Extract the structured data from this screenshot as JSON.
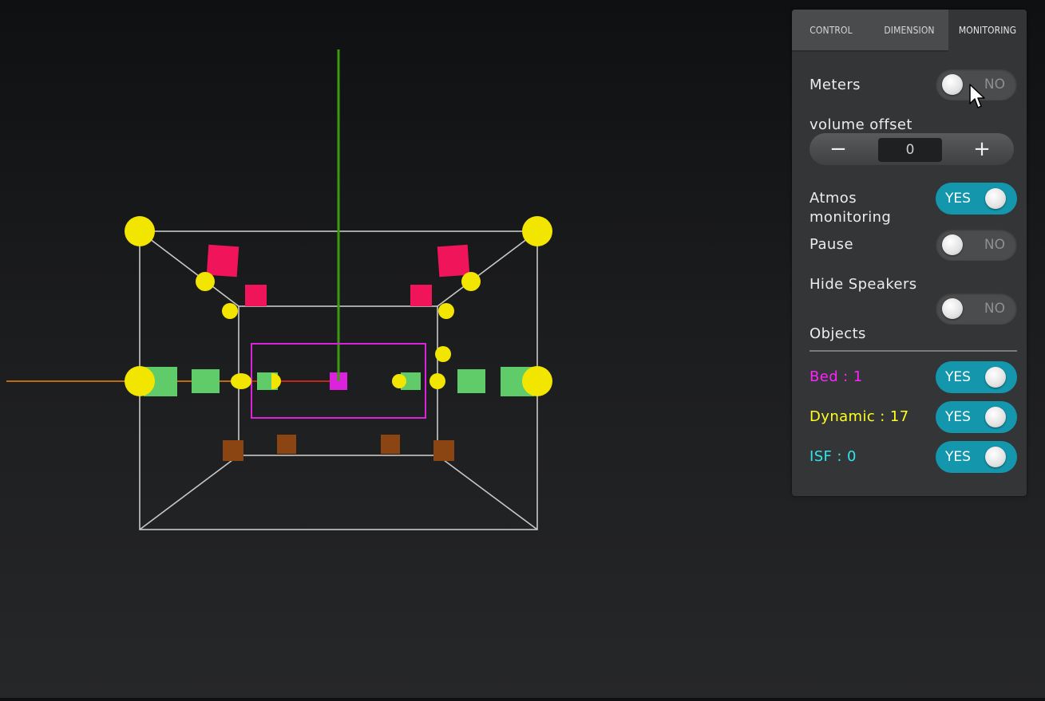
{
  "tabs": [
    {
      "label": "CONTROL",
      "active": false
    },
    {
      "label": "DIMENSION",
      "active": false
    },
    {
      "label": "MONITORING",
      "active": true
    }
  ],
  "meters": {
    "label": "Meters",
    "state": "NO"
  },
  "volume_offset": {
    "label": "volume offset",
    "value": "0",
    "minus": "−",
    "plus": "+"
  },
  "atmos": {
    "label_line1": "Atmos",
    "label_line2": "monitoring",
    "state": "YES"
  },
  "pause": {
    "label": "Pause",
    "state": "NO"
  },
  "hide_speakers": {
    "label": "Hide Speakers",
    "state": "NO"
  },
  "objects": {
    "label": "Objects",
    "bed": {
      "label": "Bed : 1",
      "color": "#ff22ff",
      "state": "YES"
    },
    "dynamic": {
      "label": "Dynamic : 17",
      "color": "#ffff1e",
      "state": "YES"
    },
    "isf": {
      "label": "ISF : 0",
      "color": "#2ee6ee",
      "state": "YES"
    }
  },
  "colors": {
    "toggle_on": "#1496ac",
    "toggle_off": "#4b4c4e",
    "speaker_yellow": "#f2e600",
    "speaker_pink": "#f0145a",
    "speaker_green": "#5fcc69",
    "speaker_brown": "#8b4513",
    "bed_magenta": "#dd22dd",
    "axis_green": "#3a9a10",
    "axis_red": "#c0281a",
    "axis_orange": "#c06a10"
  }
}
